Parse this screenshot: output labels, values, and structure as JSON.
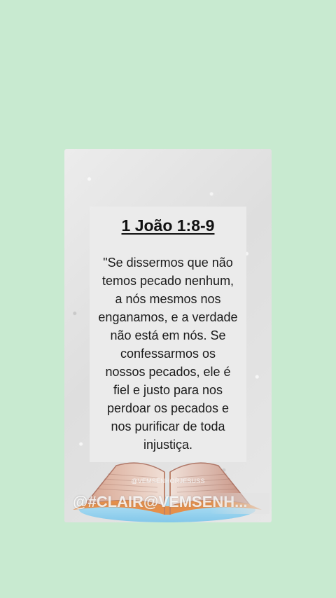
{
  "card": {
    "title": "1 João 1:8-9",
    "verse_lines": [
      "\"Se dissermos que não",
      "temos pecado nenhum,",
      "a nós mesmos nos",
      "enganamos, e a verdade",
      "não está em nós. Se",
      "confessarmos os",
      "nossos pecados, ele é",
      "fiel e justo para nos",
      "perdoar os pecados e",
      "nos purificar de toda",
      "injustiça."
    ],
    "handle_small": "@VEMSENHORJESUSS",
    "watermark": "@#CLAIR@VEMSENH..."
  },
  "colors": {
    "background": "#c8ead0",
    "card": "#e3e3e3",
    "bible_blue": "#9fd8f2",
    "bible_orange": "#e58f4b"
  }
}
